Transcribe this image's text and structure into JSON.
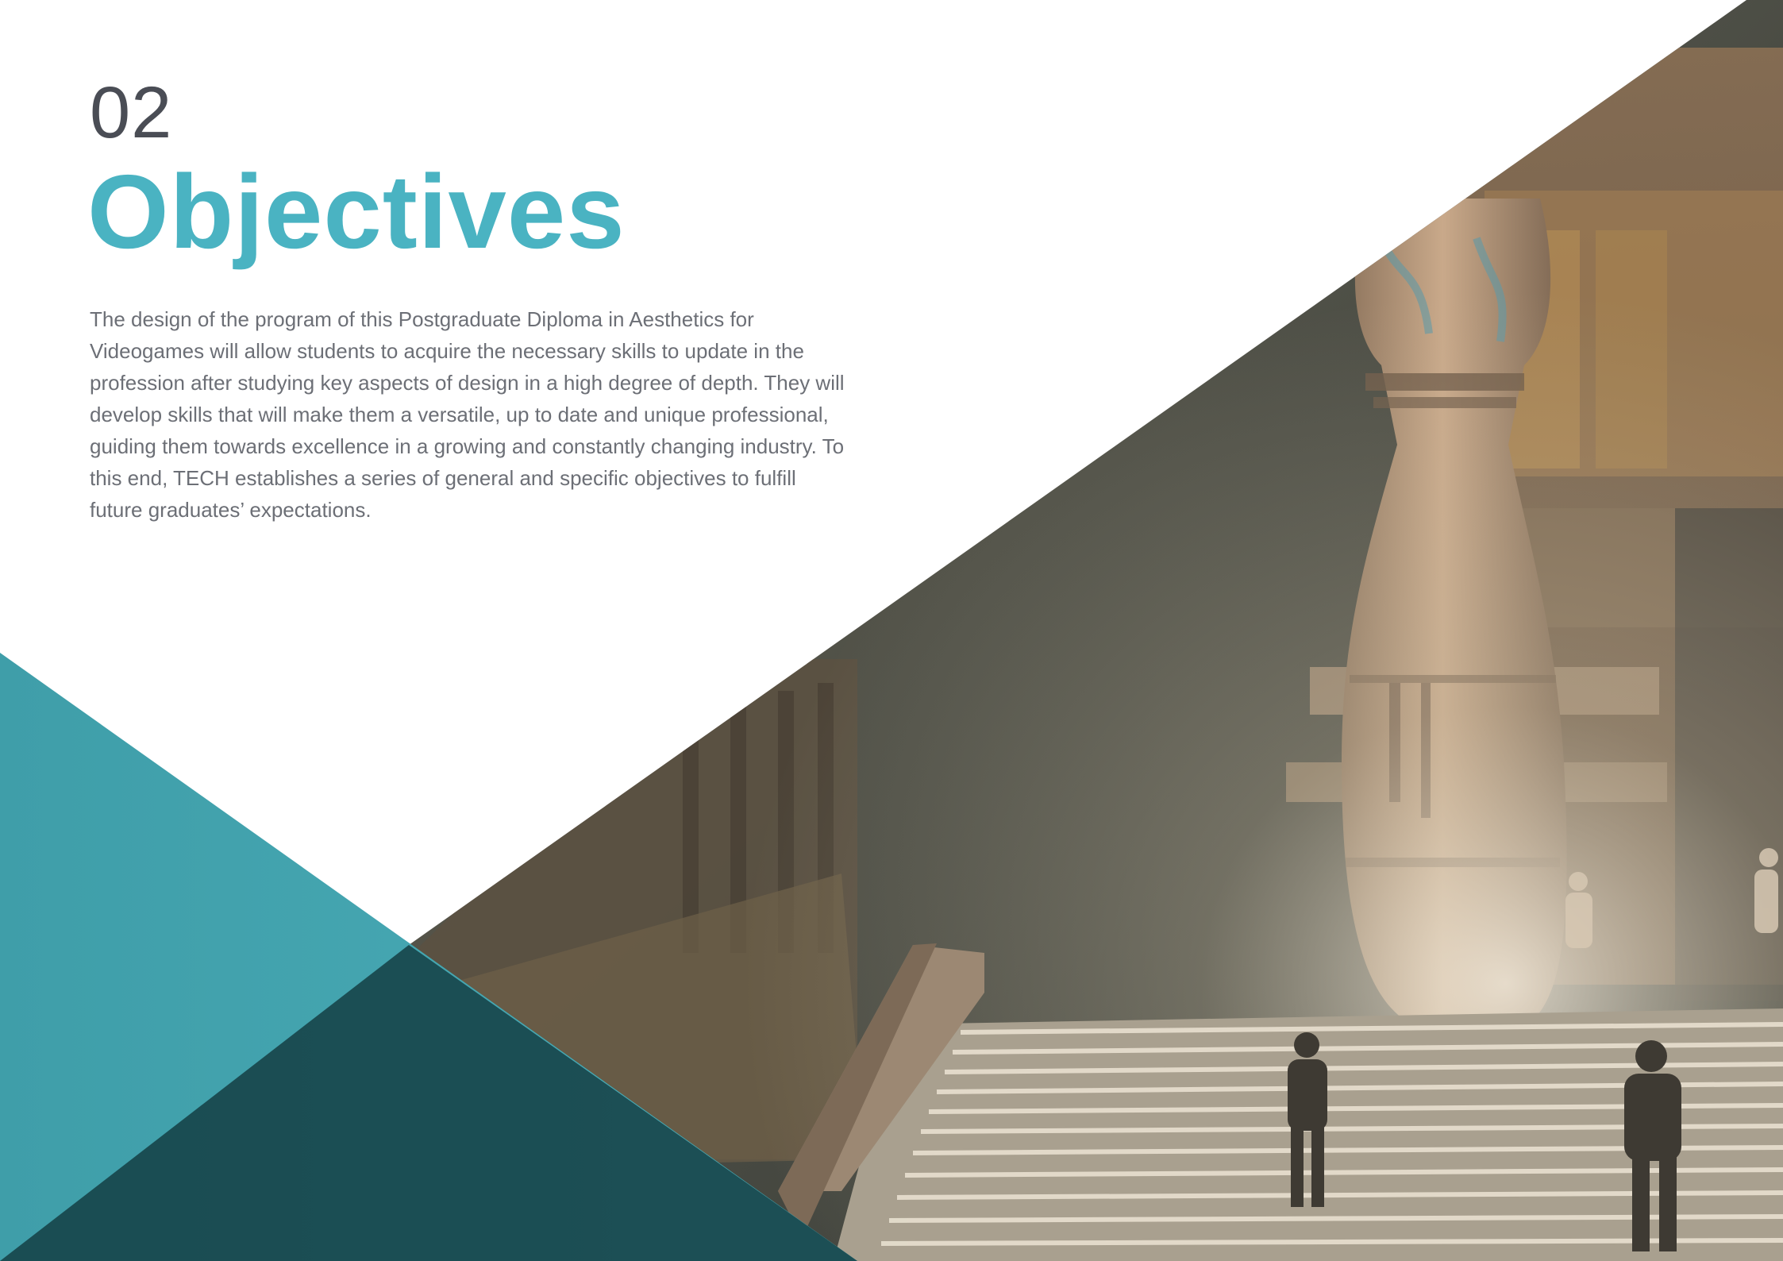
{
  "page": {
    "chapter_number": "02",
    "title": "Objectives",
    "intro_text": "The design of the program of this Postgraduate Diploma in Aesthetics for Videogames will allow students to acquire the necessary skills to update in the profession after studying key aspects of design in a high degree of depth. They will develop skills that will make them a versatile, up to date and unique professional, guiding them towards excellence in a growing and constantly changing industry. To this end, TECH establishes a series of general and specific objectives to fulfill future graduates’ expectations."
  },
  "colors": {
    "accent": "#4ab3c2",
    "teal_panel": "#45a6b2",
    "dark_teal": "#1c4b4f",
    "heading_gray": "#4a4d55",
    "body_text": "#6c6f76"
  },
  "decor": {
    "background_image": "temple-stairs-scene"
  }
}
